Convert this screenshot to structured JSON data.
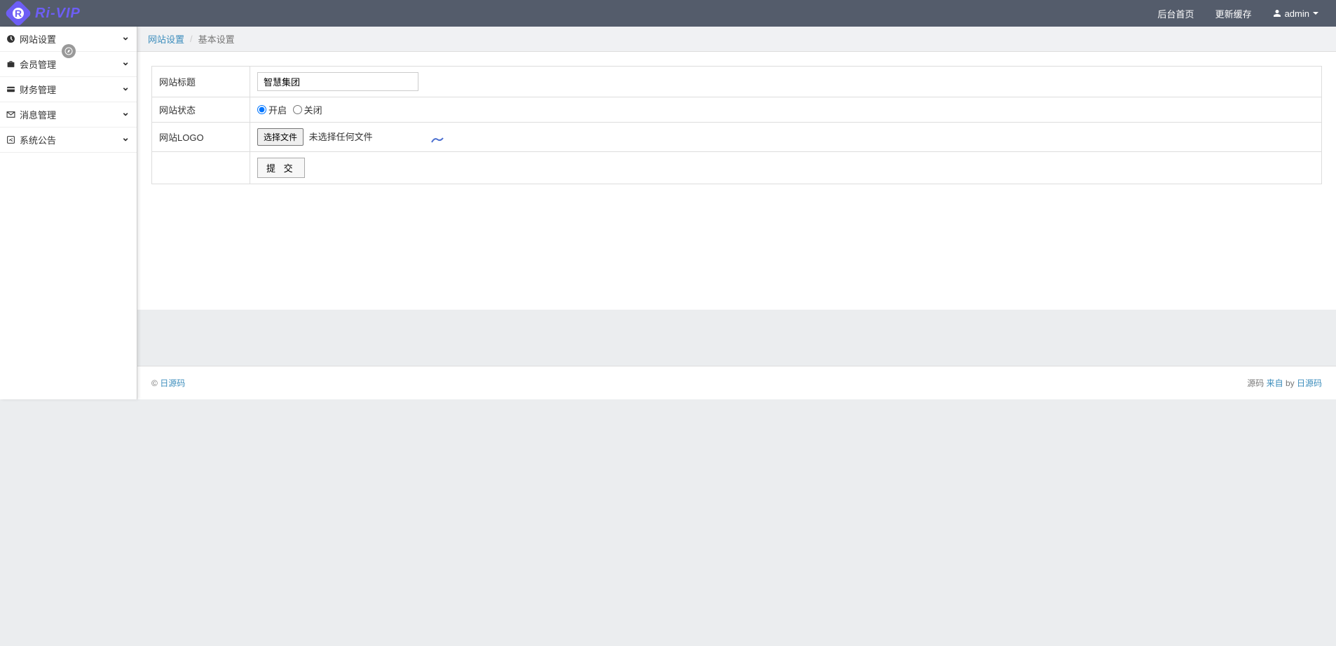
{
  "header": {
    "logo_text": "Ri-VIP",
    "nav": {
      "home": "后台首页",
      "refresh_cache": "更新缓存",
      "user": "admin"
    }
  },
  "sidebar": {
    "items": [
      {
        "label": "网站设置",
        "icon": "dashboard"
      },
      {
        "label": "会员管理",
        "icon": "briefcase"
      },
      {
        "label": "财务管理",
        "icon": "card"
      },
      {
        "label": "消息管理",
        "icon": "envelope"
      },
      {
        "label": "系统公告",
        "icon": "edit"
      }
    ]
  },
  "breadcrumb": {
    "parent": "网站设置",
    "current": "基本设置"
  },
  "form": {
    "title_label": "网站标题",
    "title_value": "智慧集团",
    "status_label": "网站状态",
    "status_open": "开启",
    "status_close": "关闭",
    "logo_label": "网站LOGO",
    "file_button": "选择文件",
    "file_status": "未选择任何文件",
    "submit": "提 交"
  },
  "footer": {
    "copyright_prefix": "©",
    "copyright_link": "日源码",
    "right_text1": "源码",
    "right_link1": "来自",
    "right_by": "by",
    "right_link2": "日源码"
  }
}
